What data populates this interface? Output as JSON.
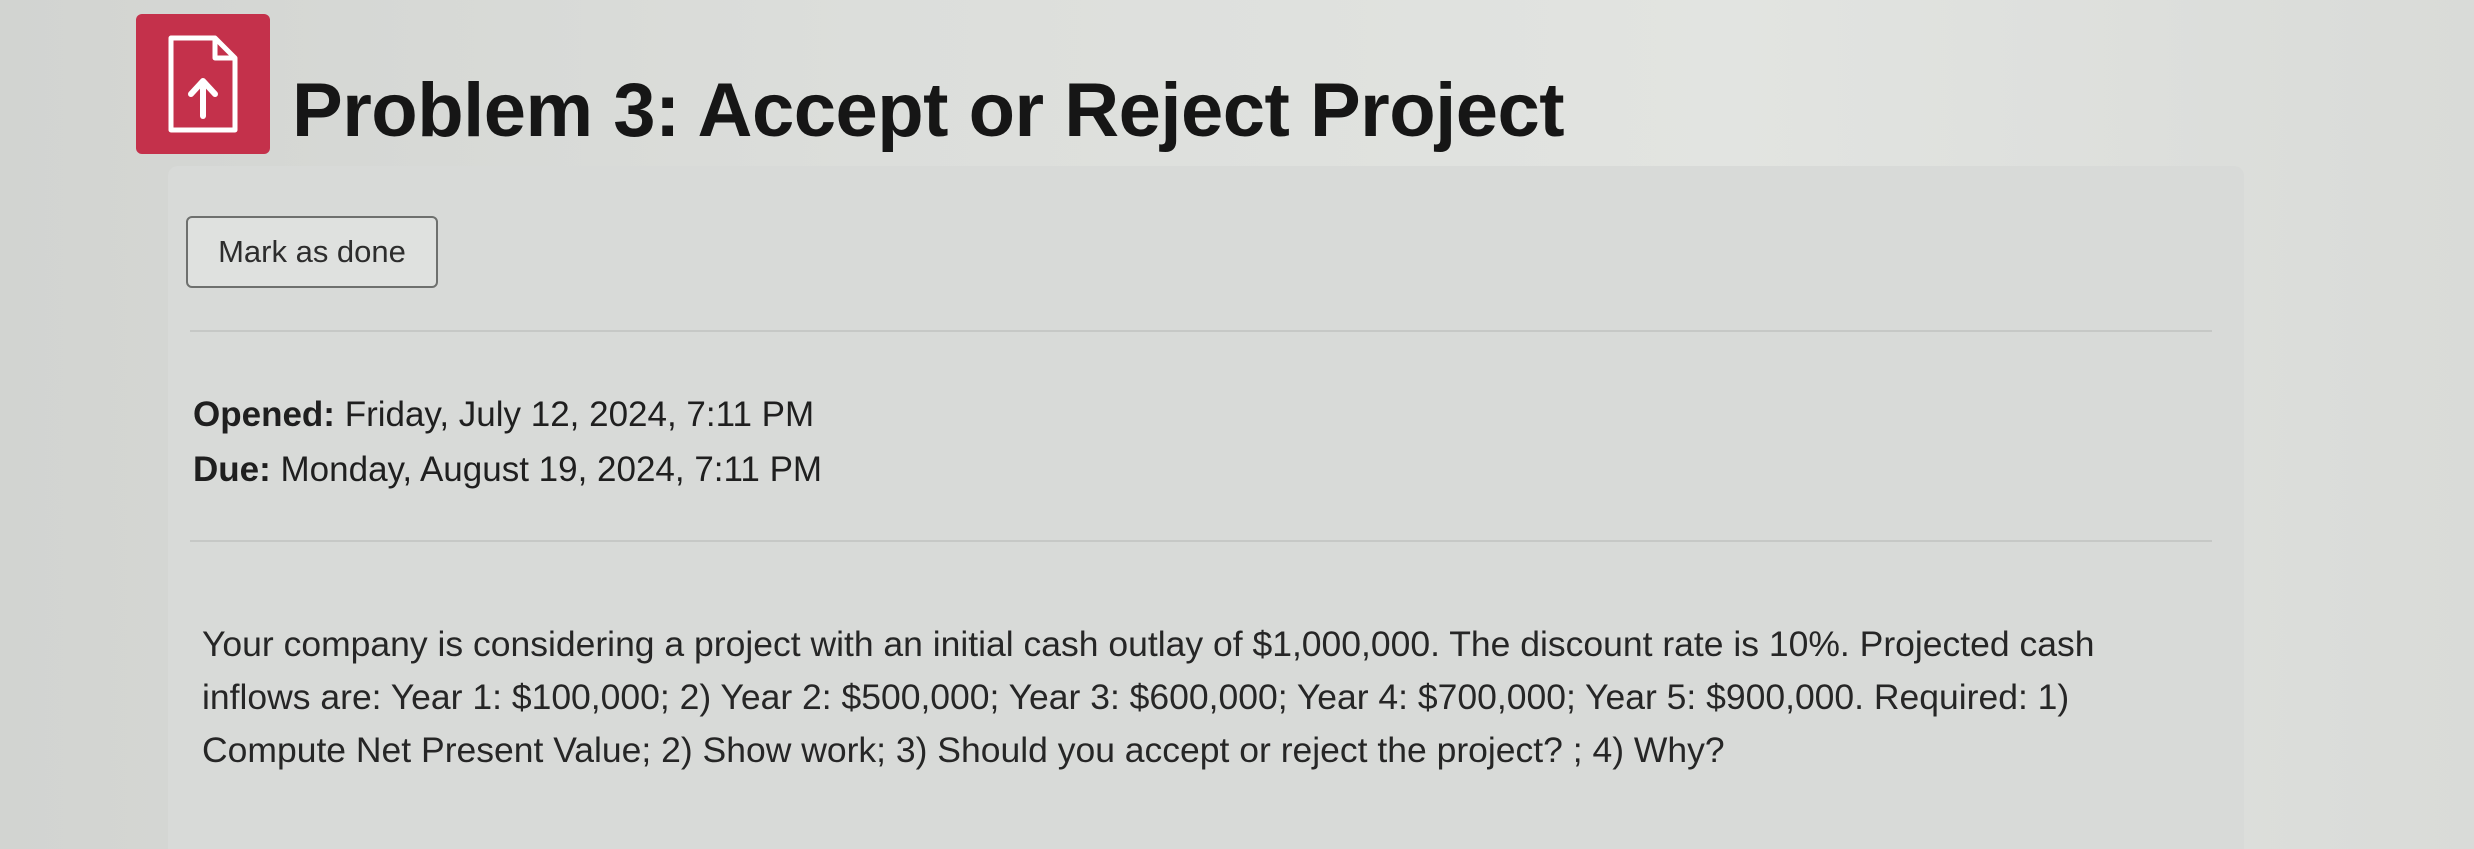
{
  "activity": {
    "icon": "assignment-upload-icon",
    "title": "Problem 3: Accept or Reject Project"
  },
  "completion": {
    "mark_done_label": "Mark as done"
  },
  "dates": {
    "opened_label": "Opened:",
    "opened_value": "Friday, July 12, 2024, 7:11 PM",
    "due_label": "Due:",
    "due_value": "Monday, August 19, 2024, 7:11 PM"
  },
  "description": {
    "text": "Your company is considering a project with an initial cash outlay of $1,000,000. The discount rate is 10%. Projected cash inflows are: Year 1: $100,000; 2) Year 2: $500,000; Year 3: $600,000; Year 4: $700,000; Year 5: $900,000. Required: 1) Compute Net Present Value; 2) Show work; 3) Should you accept or reject the project? ; 4) Why?"
  },
  "colors": {
    "icon_background": "#c4314b",
    "card_background": "#d8dad8",
    "button_border": "#6e706e"
  }
}
